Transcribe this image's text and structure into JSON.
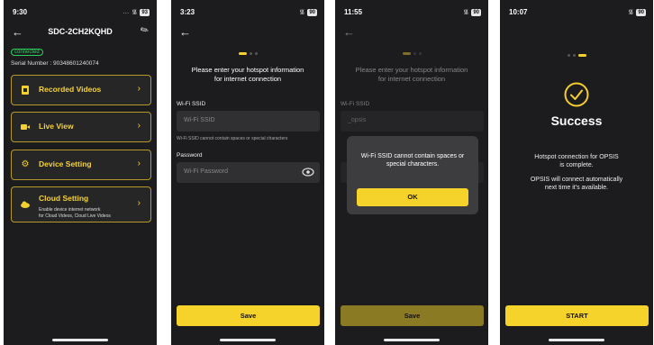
{
  "screen1": {
    "time": "9:30",
    "battery": "93",
    "title": "SDC-2CH2KQHD",
    "status_badge": "connected",
    "serial": "Serial Number : 90348601240074",
    "menu": [
      {
        "label": "Recorded Videos",
        "icon": "film-icon"
      },
      {
        "label": "Live View",
        "icon": "camera-icon"
      },
      {
        "label": "Device Setting",
        "icon": "gear-icon"
      },
      {
        "label": "Cloud Setting",
        "icon": "cloud-icon",
        "sub1": "Enable device internet network",
        "sub2": "for Cloud Videos, Cloud Live Videos"
      }
    ]
  },
  "screen2": {
    "time": "3:23",
    "battery": "90",
    "heading1": "Please enter your hotspot information",
    "heading2": "for internet connection",
    "ssid_label": "Wi-Fi SSID",
    "ssid_placeholder": "Wi-Fi SSID",
    "ssid_hint": "Wi-Fi SSID cannot contain spaces or special characters",
    "password_label": "Password",
    "password_placeholder": "Wi-Fi Password",
    "save_label": "Save"
  },
  "screen3": {
    "time": "11:55",
    "battery": "90",
    "heading1": "Please enter your hotspot information",
    "heading2": "for internet connection",
    "ssid_label": "Wi-Fi SSID",
    "ssid_value": "_opsis",
    "modal_line1": "Wi-Fi SSID cannot contain spaces or",
    "modal_line2": "special characters.",
    "ok_label": "OK",
    "save_label": "Save"
  },
  "screen4": {
    "time": "10:07",
    "battery": "90",
    "success": "Success",
    "msg1_line1": "Hotspot connection for OPSIS",
    "msg1_line2": "is complete.",
    "msg2_line1": "OPSIS will connect automatically",
    "msg2_line2": "next time it's available.",
    "start_label": "START"
  },
  "colors": {
    "accent": "#f6d32b",
    "background": "#1c1c1e",
    "connected": "#2bd15f"
  }
}
